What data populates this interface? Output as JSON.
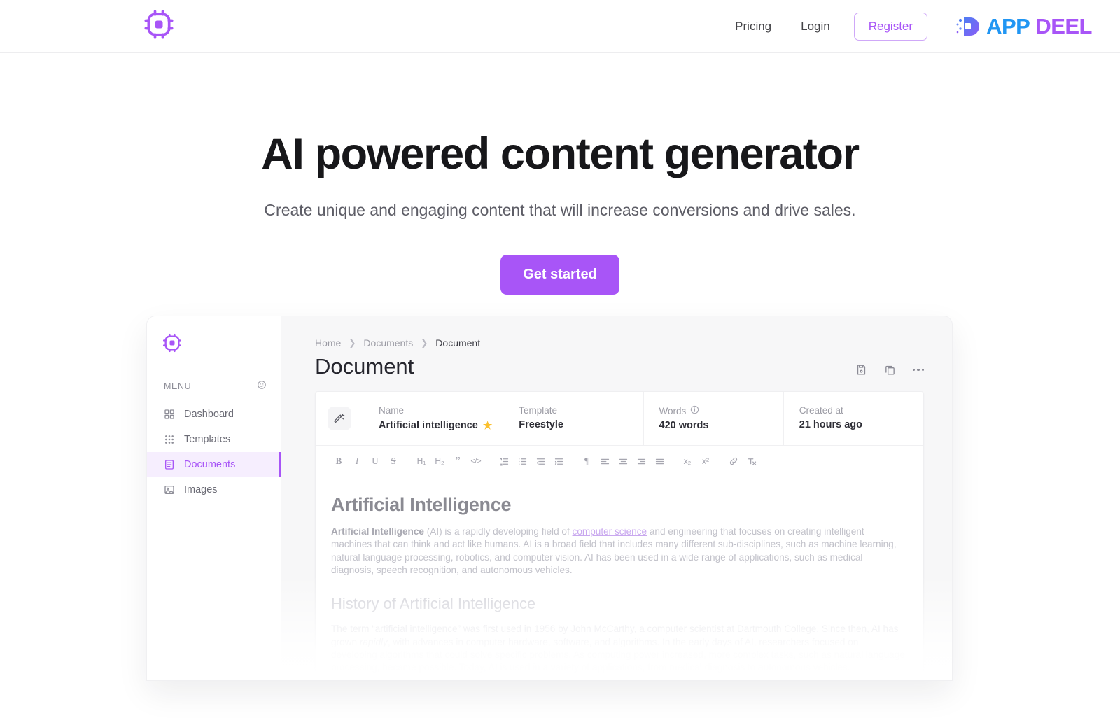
{
  "header": {
    "logo_icon": "cpu-chip-icon",
    "nav": [
      {
        "label": "Pricing"
      },
      {
        "label": "Login"
      }
    ],
    "register_label": "Register",
    "brand": {
      "part1": "APP",
      "part2": "DEEL",
      "color1": "#2196f3",
      "color2": "#a855f7"
    }
  },
  "hero": {
    "title": "AI powered content generator",
    "subtitle": "Create unique and engaging content that will increase conversions and drive sales.",
    "cta_label": "Get started",
    "cta_color": "#a855f7"
  },
  "app": {
    "sidebar": {
      "logo_icon": "cpu-chip-icon",
      "menu_label": "MENU",
      "menu_badge_icon": "face-icon",
      "items": [
        {
          "label": "Dashboard",
          "icon": "grid-2x2-icon",
          "active": false
        },
        {
          "label": "Templates",
          "icon": "grid-3x3-dots-icon",
          "active": false
        },
        {
          "label": "Documents",
          "icon": "document-list-icon",
          "active": true
        },
        {
          "label": "Images",
          "icon": "image-icon",
          "active": false
        }
      ],
      "active_color": "#a855f7"
    },
    "breadcrumb": [
      "Home",
      "Documents",
      "Document"
    ],
    "page_title": "Document",
    "actions": [
      {
        "icon": "save-floppy-icon"
      },
      {
        "icon": "copy-icon"
      },
      {
        "icon": "more-horizontal-icon"
      }
    ],
    "meta": {
      "wand_icon": "magic-wand-icon",
      "fields": [
        {
          "label": "Name",
          "value": "Artificial intelligence",
          "starred": true
        },
        {
          "label": "Template",
          "value": "Freestyle",
          "starred": false
        },
        {
          "label": "Words",
          "value": "420 words",
          "info": true
        },
        {
          "label": "Created at",
          "value": "21 hours ago",
          "starred": false
        }
      ],
      "star_glyph": "★",
      "info_glyph": "i"
    },
    "toolbar": [
      {
        "icon": "bold-icon",
        "glyph": "B"
      },
      {
        "icon": "italic-icon",
        "glyph": "I"
      },
      {
        "icon": "underline-icon",
        "glyph": "U"
      },
      {
        "icon": "strikethrough-icon",
        "glyph": "S"
      },
      {
        "icon": "heading-1-icon",
        "glyph": "H₁"
      },
      {
        "icon": "heading-2-icon",
        "glyph": "H₂"
      },
      {
        "icon": "blockquote-icon",
        "glyph": "”"
      },
      {
        "icon": "code-block-icon",
        "glyph": "</>"
      },
      {
        "icon": "ordered-list-icon",
        "glyph": "≣"
      },
      {
        "icon": "bullet-list-icon",
        "glyph": "≡"
      },
      {
        "icon": "outdent-icon",
        "glyph": "≡"
      },
      {
        "icon": "indent-icon",
        "glyph": "≡"
      },
      {
        "icon": "text-direction-icon",
        "glyph": "¶"
      },
      {
        "icon": "align-left-icon",
        "glyph": "≡"
      },
      {
        "icon": "align-center-icon",
        "glyph": "≡"
      },
      {
        "icon": "align-right-icon",
        "glyph": "≡"
      },
      {
        "icon": "align-justify-icon",
        "glyph": "≡"
      },
      {
        "icon": "subscript-icon",
        "glyph": "x₂"
      },
      {
        "icon": "superscript-icon",
        "glyph": "x²"
      },
      {
        "icon": "link-icon",
        "glyph": "ὑ7"
      },
      {
        "icon": "clear-formatting-icon",
        "glyph": "Tₓ"
      }
    ],
    "document": {
      "h1": "Artificial Intelligence",
      "p1_bold": "Artificial Intelligence",
      "p1_a": " (AI) is a rapidly developing field of ",
      "p1_link": "computer science",
      "p1_b": " and engineering that focuses on creating intelligent machines that can think and act like humans. AI is a broad field that includes many different sub-disciplines, such as machine learning, natural language processing, robotics, and computer vision. AI has been used in a wide range of applications, such as medical diagnosis, speech recognition, and autonomous vehicles.",
      "h2": "History of Artificial Intelligence",
      "p2_a": "The term “artificial intelligence” was first used in 1956 by John McCarthy, a computer scientist at Dartmouth College. Since then, AI has grown ",
      "p2_italic": "rapidly",
      "p2_b": ", with advances in computer hardware, software, and algorithms. In the early days of AI, researchers focused on developing algorithms that could solve ",
      "p2_link": "specific problems",
      "p2_c": ". As computing power increased, more complex tasks, such as natural language processing, became possible. Today, AI is used in a variety of applications, from medical diagnosis to autonomous vehicles."
    }
  }
}
